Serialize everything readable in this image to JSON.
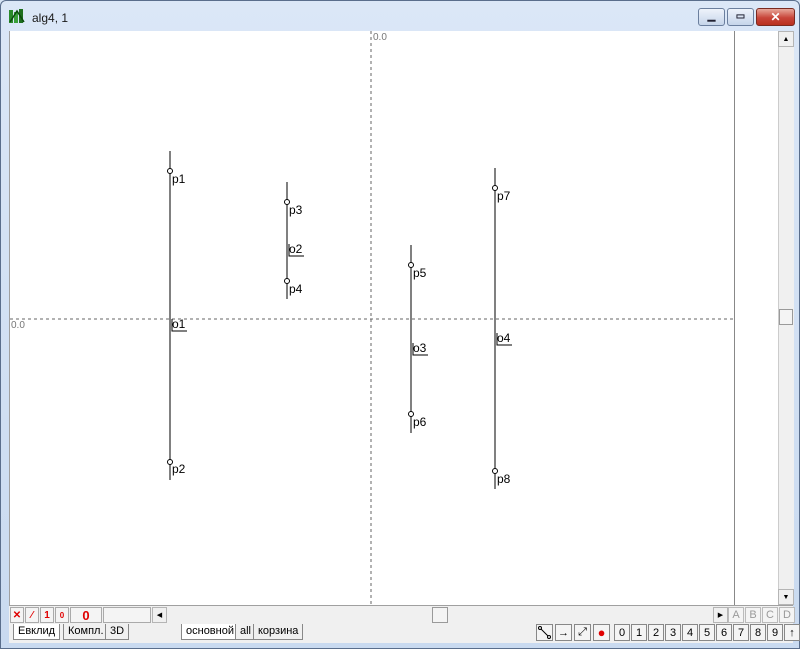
{
  "window": {
    "title": "alg4, 1",
    "min_glyph": "▁",
    "max_glyph": "▭",
    "close_glyph": "✕"
  },
  "canvas": {
    "origin_top_label": "0.0",
    "origin_left_label": "0.0",
    "segments": [
      {
        "name": "segment-p1-p2",
        "labels": [
          "p1",
          "o1",
          "p2"
        ]
      },
      {
        "name": "segment-p3-p4",
        "labels": [
          "p3",
          "o2",
          "p4"
        ]
      },
      {
        "name": "segment-p5-p6",
        "labels": [
          "p5",
          "o3",
          "p6"
        ]
      },
      {
        "name": "segment-p7-p8",
        "labels": [
          "p7",
          "o4",
          "p8"
        ]
      }
    ]
  },
  "toolbar": {
    "delete_glyph": "✕",
    "line_glyph": "⁄",
    "one_label": "1",
    "zero_small_label": "0",
    "zero_big_label": "0",
    "abcd": [
      "A",
      "B",
      "C",
      "D"
    ]
  },
  "tabs": {
    "left": [
      "Евклид",
      "Компл.",
      "3D"
    ],
    "right": [
      "основной",
      "all",
      "корзина"
    ]
  },
  "bottom_tools": {
    "digits": [
      "0",
      "1",
      "2",
      "3",
      "4",
      "5",
      "6",
      "7",
      "8",
      "9"
    ],
    "up_arrow": "↑"
  },
  "colors": {
    "accent_red": "#e00000",
    "close_button": "#c8453a"
  }
}
